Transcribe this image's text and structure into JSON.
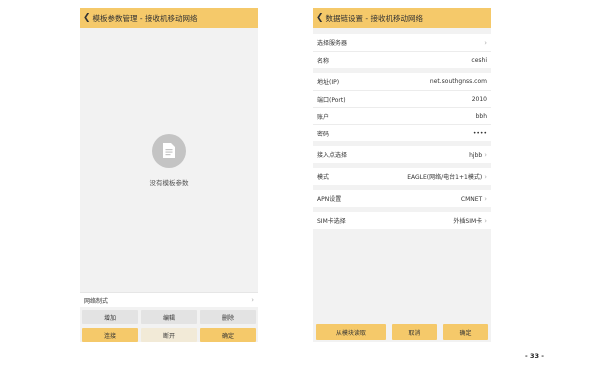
{
  "left_screen": {
    "title": "模板参数管理 - 接收机移动网络",
    "empty_text": "没有模板参数",
    "mode_row_label": "网络制式",
    "buttons_row1": [
      "增加",
      "编辑",
      "删除"
    ],
    "buttons_row2": [
      "连接",
      "断开",
      "确定"
    ]
  },
  "right_screen": {
    "title": "数据链设置 - 接收机移动网络",
    "rows": {
      "server": {
        "label": "选择服务器",
        "value": ""
      },
      "name": {
        "label": "名称",
        "value": "ceshi"
      },
      "address": {
        "label": "地址(IP)",
        "value": "net.southgnss.com"
      },
      "port": {
        "label": "端口(Port)",
        "value": "2010"
      },
      "account": {
        "label": "账户",
        "value": "bbh"
      },
      "password": {
        "label": "密码",
        "value": "••••"
      },
      "access_point": {
        "label": "接入点选择",
        "value": "hjbb"
      },
      "mode": {
        "label": "模式",
        "value": "EAGLE(网络/电台1+1模式)"
      },
      "apn": {
        "label": "APN设置",
        "value": "CMNET"
      },
      "sim": {
        "label": "SIM卡选择",
        "value": "外插SIM卡"
      }
    },
    "buttons": [
      "从模块读取",
      "取消",
      "确定"
    ]
  },
  "page_number": "- 33 -",
  "colors": {
    "accent": "#f5c96a",
    "background": "#f2f2f2"
  }
}
